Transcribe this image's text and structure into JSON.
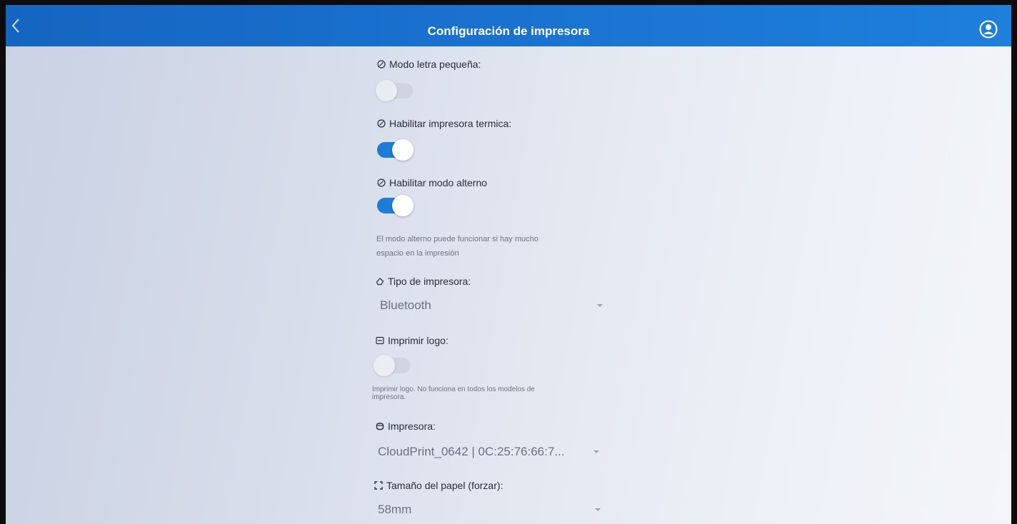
{
  "app_bar": {
    "title": "Configuración de impresora",
    "back_icon": "chevron-left-icon",
    "account_icon": "account-circle-icon"
  },
  "settings": {
    "small_font": {
      "label": "Modo letra pequeña:",
      "icon": "circle-check-icon",
      "enabled": false
    },
    "thermal_printer": {
      "label": "Habilitar impresora termica:",
      "icon": "circle-check-icon",
      "enabled": true
    },
    "alternate_mode": {
      "label": "Habilitar modo alterno",
      "icon": "circle-check-icon",
      "enabled": true,
      "hint_line1": "El modo alterno puede funcionar si hay mucho",
      "hint_line2": "espacio en la impresión"
    },
    "printer_type": {
      "label": "Tipo de impresora:",
      "icon": "printer-type-icon",
      "value": "Bluetooth"
    },
    "print_logo": {
      "label": "Imprimir logo:",
      "icon": "image-icon",
      "enabled": false,
      "hint_line1": "Imprimir logo. No funciona en todos los modelos de",
      "hint_line2": "impresora."
    },
    "printer": {
      "label": "Impresora:",
      "icon": "printer-icon",
      "value": "CloudPrint_0642 | 0C:25:76:66:7..."
    },
    "paper_size": {
      "label": "Tamaño del papel (forzar):",
      "icon": "expand-icon",
      "value": "58mm"
    }
  },
  "colors": {
    "app_bar": "#1a72d0",
    "toggle_on": "#1f7bd8",
    "toggle_off": "#c8ccd6"
  }
}
